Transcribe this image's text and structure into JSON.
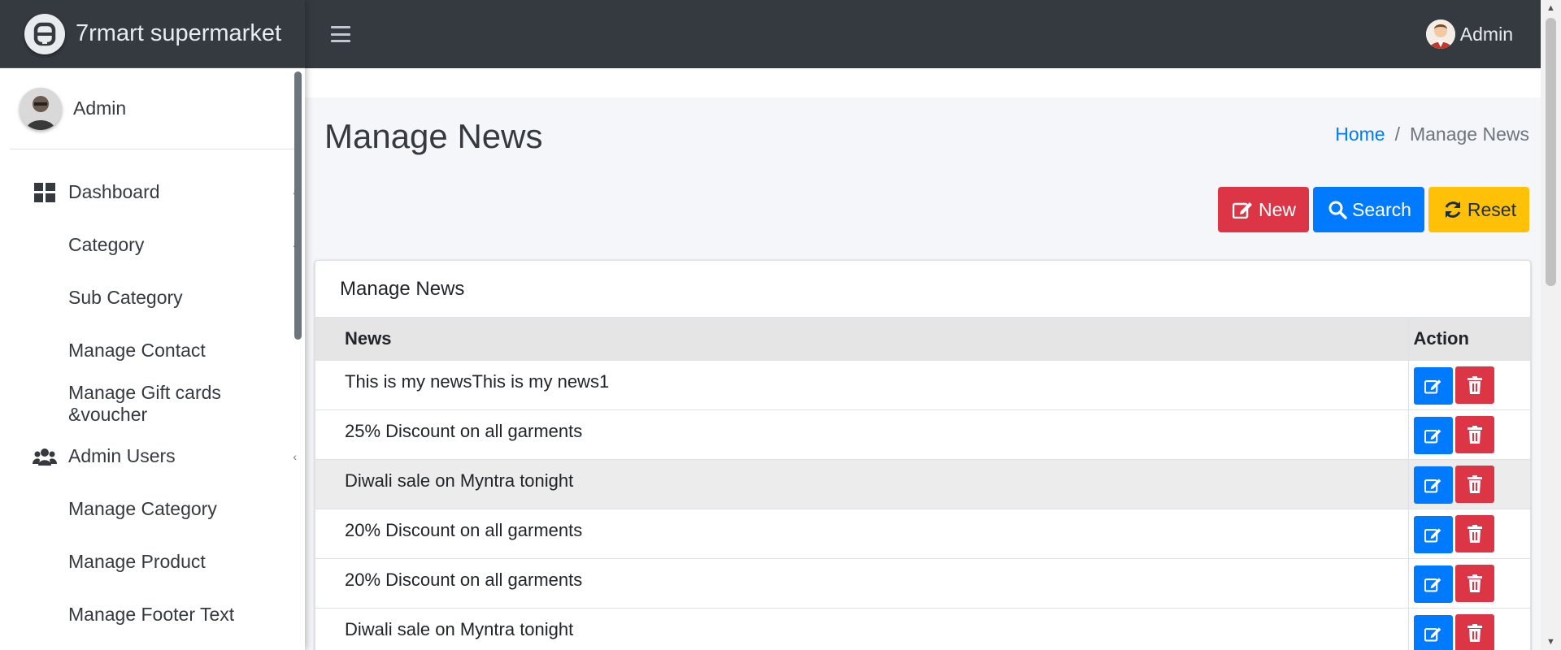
{
  "brand": {
    "name": "7rmart supermarket"
  },
  "sidebar": {
    "user_name": "Admin",
    "items": [
      {
        "label": "Dashboard",
        "icon": "dashboard-grid-icon",
        "has_caret": true
      },
      {
        "label": "Category",
        "sub": true,
        "has_caret": true
      },
      {
        "label": "Sub Category",
        "sub": true
      },
      {
        "label": "Manage Contact",
        "sub": true
      },
      {
        "label": "Manage Gift cards &voucher",
        "sub": true
      },
      {
        "label": "Admin Users",
        "icon": "users-icon",
        "has_caret": true
      },
      {
        "label": "Manage Category",
        "sub": true
      },
      {
        "label": "Manage Product",
        "sub": true
      },
      {
        "label": "Manage Footer Text",
        "sub": true
      }
    ]
  },
  "topbar": {
    "user_name": "Admin"
  },
  "page": {
    "title": "Manage News",
    "breadcrumb": {
      "home": "Home",
      "separator": "/",
      "current": "Manage News"
    }
  },
  "actions": {
    "new_label": "New",
    "search_label": "Search",
    "reset_label": "Reset"
  },
  "card": {
    "title": "Manage News",
    "columns": [
      "News",
      "Action"
    ],
    "rows": [
      "This is my newsThis is my news1",
      "25% Discount on all garments",
      "Diwali sale on Myntra tonight",
      "20% Discount on all garments",
      "20% Discount on all garments",
      "Diwali sale on Myntra tonight"
    ]
  },
  "colors": {
    "topbar": "#343a40",
    "primary": "#007bff",
    "danger": "#dc3545",
    "warning": "#ffc107"
  }
}
